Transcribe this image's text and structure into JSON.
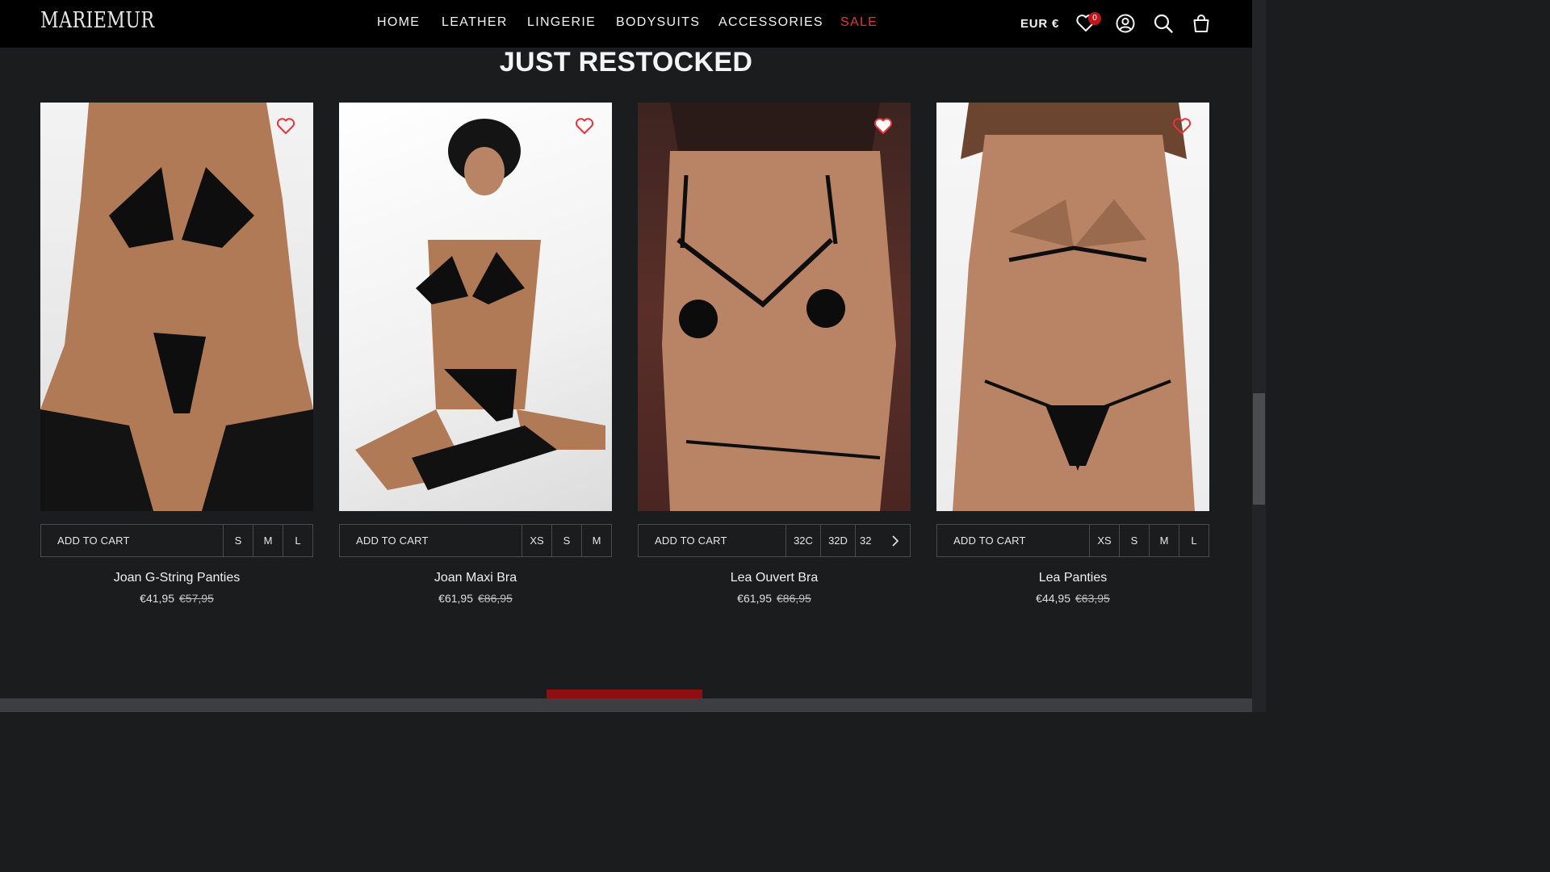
{
  "header": {
    "logo": "MARIEMUR",
    "nav": [
      "HOME",
      "LEATHER",
      "LINGERIE",
      "BODYSUITS",
      "ACCESSORIES",
      "SALE"
    ],
    "currency": "EUR €",
    "wishlist_count": "0",
    "icons": [
      "heart-icon",
      "account-icon",
      "search-icon",
      "bag-icon"
    ],
    "sale_color": "#e8333b"
  },
  "section": {
    "title": "JUST RESTOCKED"
  },
  "products": [
    {
      "name": "Joan G-String Panties",
      "price": "€41,95",
      "old_price": "€57,95",
      "add_to_cart": "ADD TO CART",
      "sizes": [
        "S",
        "M",
        "L"
      ]
    },
    {
      "name": "Joan Maxi Bra",
      "price": "€61,95",
      "old_price": "€86,95",
      "add_to_cart": "ADD TO CART",
      "sizes": [
        "XS",
        "S",
        "M"
      ]
    },
    {
      "name": "Lea Ouvert Bra",
      "price": "€61,95",
      "old_price": "€86,95",
      "add_to_cart": "ADD TO CART",
      "sizes": [
        "32C",
        "32D",
        "32"
      ]
    },
    {
      "name": "Lea Panties",
      "price": "€44,95",
      "old_price": "€63,95",
      "add_to_cart": "ADD TO CART",
      "sizes": [
        "XS",
        "S",
        "M",
        "L"
      ]
    }
  ]
}
